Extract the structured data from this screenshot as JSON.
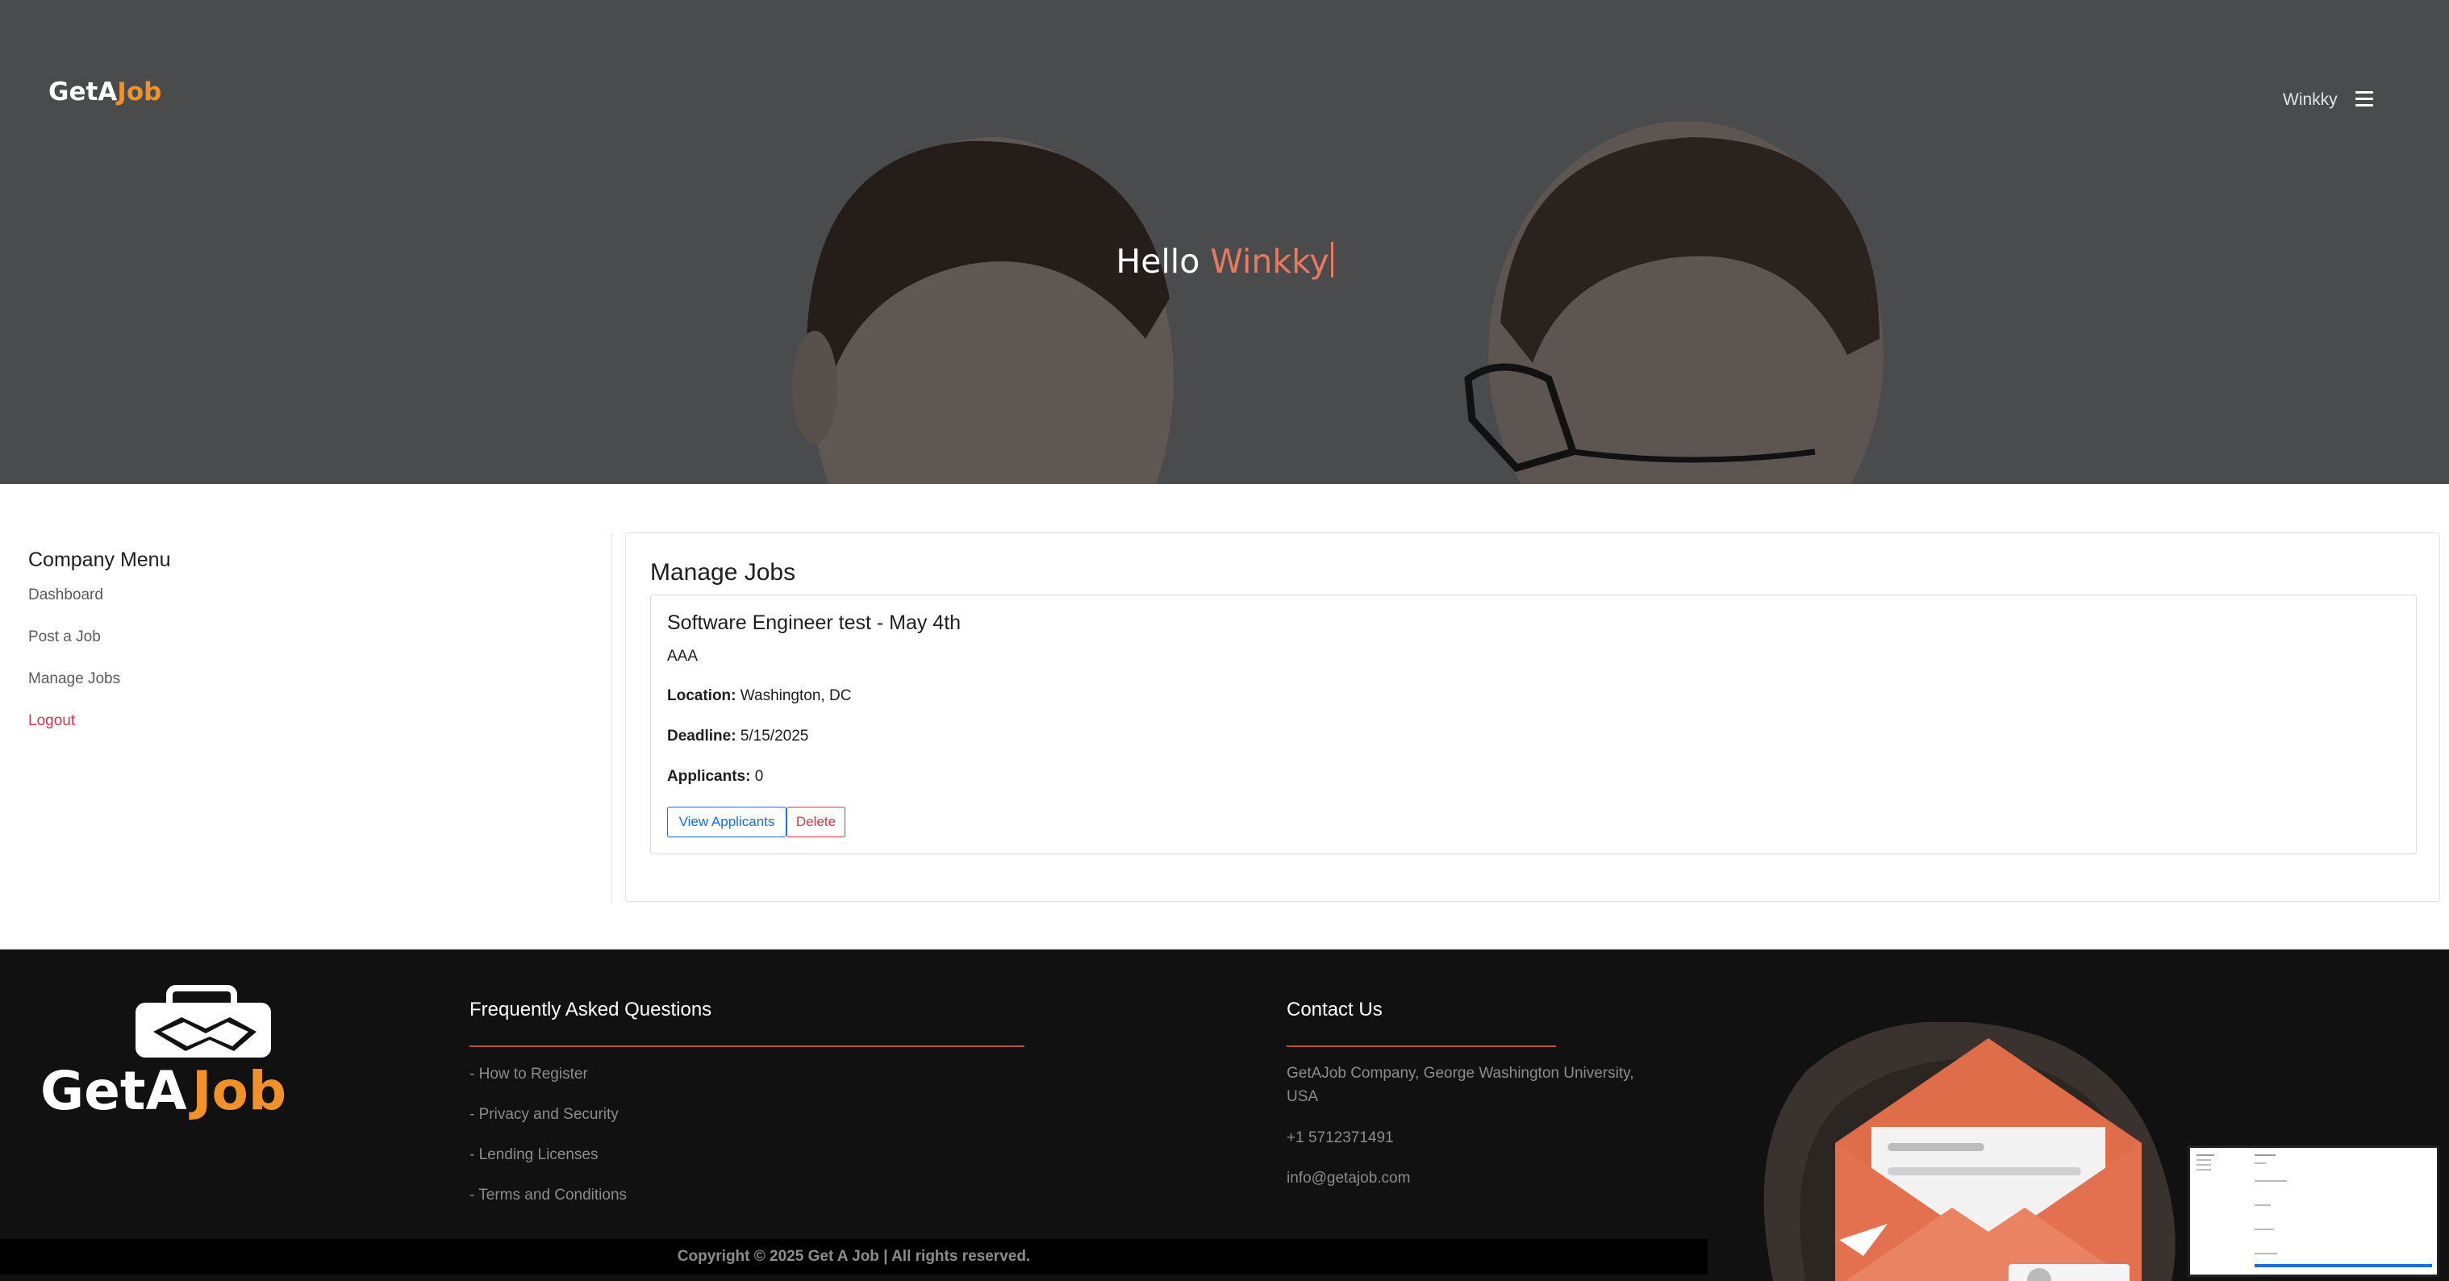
{
  "header": {
    "brand_part1": "GetA",
    "brand_part2": "Job",
    "user_name": "Winkky",
    "greeting": "Hello",
    "greeting_name": "Winkky"
  },
  "sidebar": {
    "title": "Company Menu",
    "items": [
      {
        "label": "Dashboard"
      },
      {
        "label": "Post a Job"
      },
      {
        "label": "Manage Jobs"
      },
      {
        "label": "Logout"
      }
    ]
  },
  "main": {
    "title": "Manage Jobs",
    "job": {
      "title": "Software Engineer test - May 4th",
      "company": "AAA",
      "location_label": "Location:",
      "location": "Washington, DC",
      "deadline_label": "Deadline:",
      "deadline": "5/15/2025",
      "applicants_label": "Applicants:",
      "applicants": "0",
      "view_button": "View Applicants",
      "delete_button": "Delete"
    }
  },
  "footer": {
    "logo_text": "GetAJob",
    "faq_title": "Frequently Asked Questions",
    "faq_links": [
      {
        "label": "- How to Register"
      },
      {
        "label": "- Privacy and Security"
      },
      {
        "label": "- Lending Licenses"
      },
      {
        "label": "- Terms and Conditions"
      }
    ],
    "contact_title": "Contact Us",
    "contact_address": "GetAJob Company, George Washington University, USA",
    "contact_phone": "+1 5712371491",
    "contact_email": "info@getajob.com",
    "copyright": "Copyright © 2025 Get A Job | All rights reserved."
  },
  "colors": {
    "accent_orange": "#f0912a",
    "greeting_name": "#e9785f",
    "link_blue": "#0d6efd",
    "danger_red": "#dc3545",
    "footer_bg": "#111111"
  }
}
